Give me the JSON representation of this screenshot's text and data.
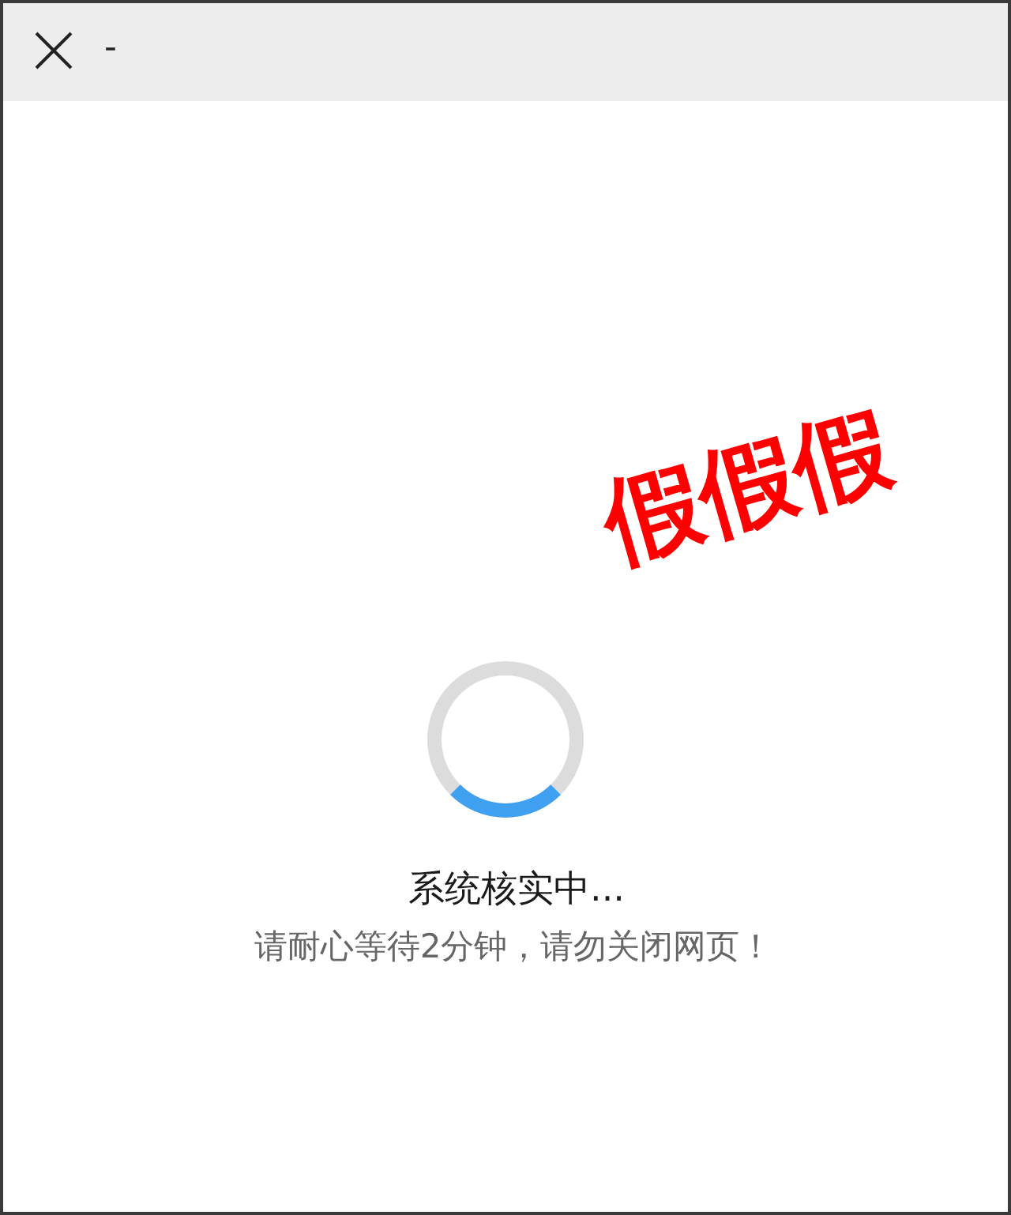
{
  "header": {
    "title": "-"
  },
  "loader": {
    "title": "系统核实中...",
    "message": "请耐心等待2分钟，请勿关闭网页！"
  },
  "stamp": {
    "text": "假假假"
  }
}
